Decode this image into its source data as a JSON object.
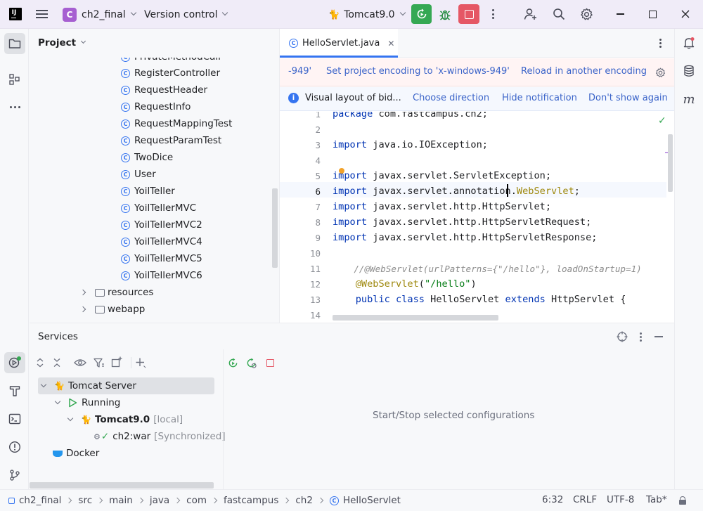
{
  "titlebar": {
    "project_badge": "C",
    "project_name": "ch2_final",
    "vcs_label": "Version control",
    "run_config": "Tomcat9.0"
  },
  "colors": {
    "accent": "#3574f0",
    "run_green": "#35a853",
    "stop_red": "#e55765",
    "title_bg": "#f0ecf8",
    "project_badge": "#a65fd1"
  },
  "project_panel": {
    "title": "Project",
    "items": [
      {
        "label": "PrivateMethodCall",
        "type": "class"
      },
      {
        "label": "RegisterController",
        "type": "class"
      },
      {
        "label": "RequestHeader",
        "type": "class"
      },
      {
        "label": "RequestInfo",
        "type": "class"
      },
      {
        "label": "RequestMappingTest",
        "type": "class"
      },
      {
        "label": "RequestParamTest",
        "type": "class"
      },
      {
        "label": "TwoDice",
        "type": "class"
      },
      {
        "label": "User",
        "type": "class"
      },
      {
        "label": "YoilTeller",
        "type": "class"
      },
      {
        "label": "YoilTellerMVC",
        "type": "class"
      },
      {
        "label": "YoilTellerMVC2",
        "type": "class"
      },
      {
        "label": "YoilTellerMVC4",
        "type": "class"
      },
      {
        "label": "YoilTellerMVC5",
        "type": "class"
      },
      {
        "label": "YoilTellerMVC6",
        "type": "class"
      },
      {
        "label": "resources",
        "type": "folder"
      },
      {
        "label": "webapp",
        "type": "folder"
      }
    ]
  },
  "editor": {
    "tab_label": "HelloServlet.java",
    "encoding_banner": {
      "encoding": "-949'",
      "set_action": "Set project encoding to 'x-windows-949'",
      "reload_action": "Reload in another encoding"
    },
    "bidi_banner": {
      "message": "Visual layout of bid...",
      "choose_direction": "Choose direction",
      "hide_notification": "Hide notification",
      "dont_show": "Don't show again"
    },
    "line_numbers": [
      "1",
      "2",
      "3",
      "4",
      "5",
      "6",
      "7",
      "8",
      "9",
      "10",
      "11",
      "12",
      "13",
      "14"
    ],
    "lines": [
      "package com.fastcampus.ch2;",
      "",
      "import java.io.IOException;",
      "",
      "import javax.servlet.ServletException;",
      "import javax.servlet.annotation.WebServlet;",
      "import javax.servlet.http.HttpServlet;",
      "import javax.servlet.http.HttpServletRequest;",
      "import javax.servlet.http.HttpServletResponse;",
      "",
      "    //@WebServlet(urlPatterns={\"/hello\"}, loadOnStartup=1)",
      "    @WebServlet(\"/hello\")",
      "    public class HelloServlet extends HttpServlet {",
      ""
    ]
  },
  "services": {
    "title": "Services",
    "tree": {
      "tomcat_server": "Tomcat Server",
      "running": "Running",
      "tomcat_instance": "Tomcat9.0",
      "tomcat_instance_suffix": "[local]",
      "artifact": "ch2:war",
      "artifact_suffix": "[Synchronized]",
      "docker": "Docker"
    },
    "empty_message": "Start/Stop selected configurations"
  },
  "statusbar": {
    "breadcrumbs": [
      "ch2_final",
      "src",
      "main",
      "java",
      "com",
      "fastcampus",
      "ch2",
      "HelloServlet"
    ],
    "cursor": "6:32",
    "line_separator": "CRLF",
    "encoding": "UTF-8",
    "indent": "Tab*"
  }
}
